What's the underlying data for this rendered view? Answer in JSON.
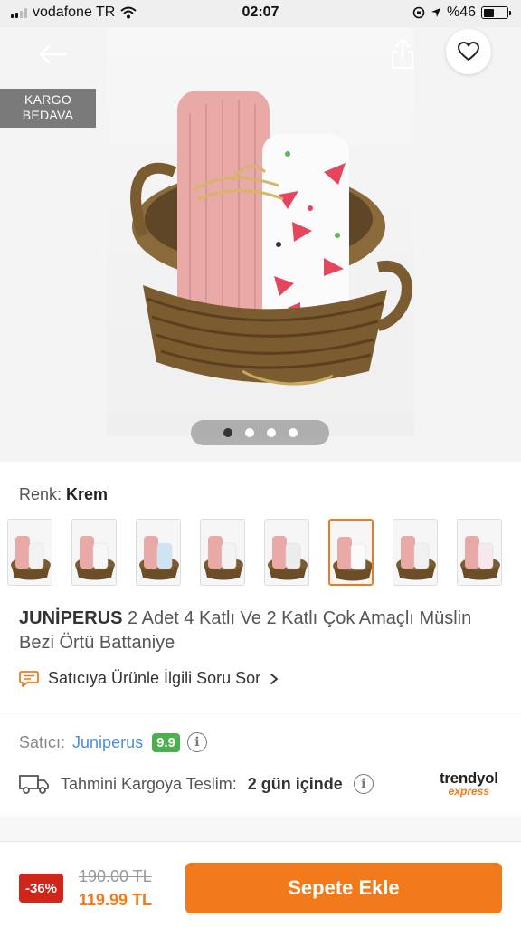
{
  "status_bar": {
    "carrier": "vodafone TR",
    "time": "02:07",
    "battery_percent": "%46",
    "battery_level": 0.46
  },
  "hero": {
    "badge_line1": "KARGO",
    "badge_line2": "BEDAVA",
    "image_count": 4,
    "active_image": 1
  },
  "color": {
    "label": "Renk:",
    "value": "Krem",
    "thumbnail_count": 8,
    "selected_index": 5
  },
  "product": {
    "brand": "JUNİPERUS",
    "name": "2 Adet 4 Katlı Ve 2 Katlı Çok Amaçlı Müslin Bezi Örtü Battaniye"
  },
  "ask_seller": {
    "label": "Satıcıya Ürünle İlgili Soru Sor"
  },
  "seller": {
    "label": "Satıcı:",
    "name": "Juniperus",
    "rating": "9.9"
  },
  "delivery": {
    "label": "Tahmini Kargoya Teslim:",
    "value": "2 gün içinde",
    "logo_line1": "trendyol",
    "logo_line2": "express"
  },
  "price": {
    "discount": "-36%",
    "old_price": "190.00 TL",
    "new_price": "119.99 TL"
  },
  "cart_button": {
    "label": "Sepete Ekle"
  },
  "colors": {
    "accent": "#f27a1a",
    "discount_red": "#d0251b",
    "rating_green": "#4caf50",
    "link_blue": "#4a90d9"
  }
}
